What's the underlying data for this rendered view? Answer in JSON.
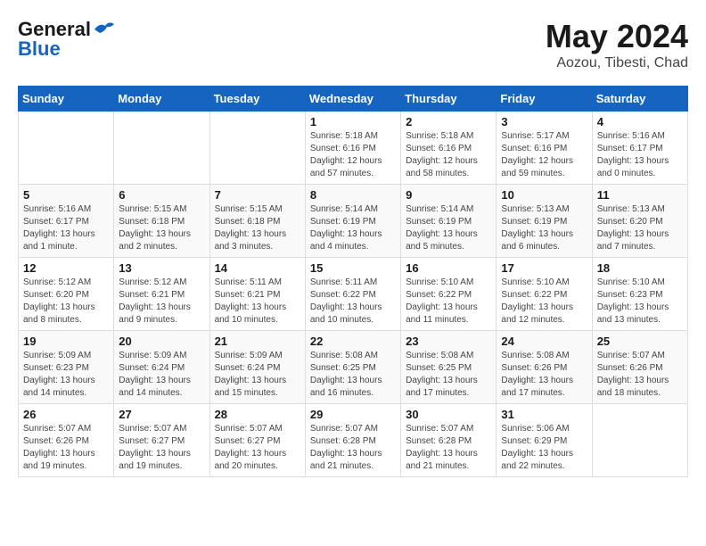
{
  "logo": {
    "general": "General",
    "blue": "Blue"
  },
  "title": "May 2024",
  "location": "Aozou, Tibesti, Chad",
  "weekdays": [
    "Sunday",
    "Monday",
    "Tuesday",
    "Wednesday",
    "Thursday",
    "Friday",
    "Saturday"
  ],
  "weeks": [
    [
      {
        "day": "",
        "info": ""
      },
      {
        "day": "",
        "info": ""
      },
      {
        "day": "",
        "info": ""
      },
      {
        "day": "1",
        "info": "Sunrise: 5:18 AM\nSunset: 6:16 PM\nDaylight: 12 hours\nand 57 minutes."
      },
      {
        "day": "2",
        "info": "Sunrise: 5:18 AM\nSunset: 6:16 PM\nDaylight: 12 hours\nand 58 minutes."
      },
      {
        "day": "3",
        "info": "Sunrise: 5:17 AM\nSunset: 6:16 PM\nDaylight: 12 hours\nand 59 minutes."
      },
      {
        "day": "4",
        "info": "Sunrise: 5:16 AM\nSunset: 6:17 PM\nDaylight: 13 hours\nand 0 minutes."
      }
    ],
    [
      {
        "day": "5",
        "info": "Sunrise: 5:16 AM\nSunset: 6:17 PM\nDaylight: 13 hours\nand 1 minute."
      },
      {
        "day": "6",
        "info": "Sunrise: 5:15 AM\nSunset: 6:18 PM\nDaylight: 13 hours\nand 2 minutes."
      },
      {
        "day": "7",
        "info": "Sunrise: 5:15 AM\nSunset: 6:18 PM\nDaylight: 13 hours\nand 3 minutes."
      },
      {
        "day": "8",
        "info": "Sunrise: 5:14 AM\nSunset: 6:19 PM\nDaylight: 13 hours\nand 4 minutes."
      },
      {
        "day": "9",
        "info": "Sunrise: 5:14 AM\nSunset: 6:19 PM\nDaylight: 13 hours\nand 5 minutes."
      },
      {
        "day": "10",
        "info": "Sunrise: 5:13 AM\nSunset: 6:19 PM\nDaylight: 13 hours\nand 6 minutes."
      },
      {
        "day": "11",
        "info": "Sunrise: 5:13 AM\nSunset: 6:20 PM\nDaylight: 13 hours\nand 7 minutes."
      }
    ],
    [
      {
        "day": "12",
        "info": "Sunrise: 5:12 AM\nSunset: 6:20 PM\nDaylight: 13 hours\nand 8 minutes."
      },
      {
        "day": "13",
        "info": "Sunrise: 5:12 AM\nSunset: 6:21 PM\nDaylight: 13 hours\nand 9 minutes."
      },
      {
        "day": "14",
        "info": "Sunrise: 5:11 AM\nSunset: 6:21 PM\nDaylight: 13 hours\nand 10 minutes."
      },
      {
        "day": "15",
        "info": "Sunrise: 5:11 AM\nSunset: 6:22 PM\nDaylight: 13 hours\nand 10 minutes."
      },
      {
        "day": "16",
        "info": "Sunrise: 5:10 AM\nSunset: 6:22 PM\nDaylight: 13 hours\nand 11 minutes."
      },
      {
        "day": "17",
        "info": "Sunrise: 5:10 AM\nSunset: 6:22 PM\nDaylight: 13 hours\nand 12 minutes."
      },
      {
        "day": "18",
        "info": "Sunrise: 5:10 AM\nSunset: 6:23 PM\nDaylight: 13 hours\nand 13 minutes."
      }
    ],
    [
      {
        "day": "19",
        "info": "Sunrise: 5:09 AM\nSunset: 6:23 PM\nDaylight: 13 hours\nand 14 minutes."
      },
      {
        "day": "20",
        "info": "Sunrise: 5:09 AM\nSunset: 6:24 PM\nDaylight: 13 hours\nand 14 minutes."
      },
      {
        "day": "21",
        "info": "Sunrise: 5:09 AM\nSunset: 6:24 PM\nDaylight: 13 hours\nand 15 minutes."
      },
      {
        "day": "22",
        "info": "Sunrise: 5:08 AM\nSunset: 6:25 PM\nDaylight: 13 hours\nand 16 minutes."
      },
      {
        "day": "23",
        "info": "Sunrise: 5:08 AM\nSunset: 6:25 PM\nDaylight: 13 hours\nand 17 minutes."
      },
      {
        "day": "24",
        "info": "Sunrise: 5:08 AM\nSunset: 6:26 PM\nDaylight: 13 hours\nand 17 minutes."
      },
      {
        "day": "25",
        "info": "Sunrise: 5:07 AM\nSunset: 6:26 PM\nDaylight: 13 hours\nand 18 minutes."
      }
    ],
    [
      {
        "day": "26",
        "info": "Sunrise: 5:07 AM\nSunset: 6:26 PM\nDaylight: 13 hours\nand 19 minutes."
      },
      {
        "day": "27",
        "info": "Sunrise: 5:07 AM\nSunset: 6:27 PM\nDaylight: 13 hours\nand 19 minutes."
      },
      {
        "day": "28",
        "info": "Sunrise: 5:07 AM\nSunset: 6:27 PM\nDaylight: 13 hours\nand 20 minutes."
      },
      {
        "day": "29",
        "info": "Sunrise: 5:07 AM\nSunset: 6:28 PM\nDaylight: 13 hours\nand 21 minutes."
      },
      {
        "day": "30",
        "info": "Sunrise: 5:07 AM\nSunset: 6:28 PM\nDaylight: 13 hours\nand 21 minutes."
      },
      {
        "day": "31",
        "info": "Sunrise: 5:06 AM\nSunset: 6:29 PM\nDaylight: 13 hours\nand 22 minutes."
      },
      {
        "day": "",
        "info": ""
      }
    ]
  ]
}
